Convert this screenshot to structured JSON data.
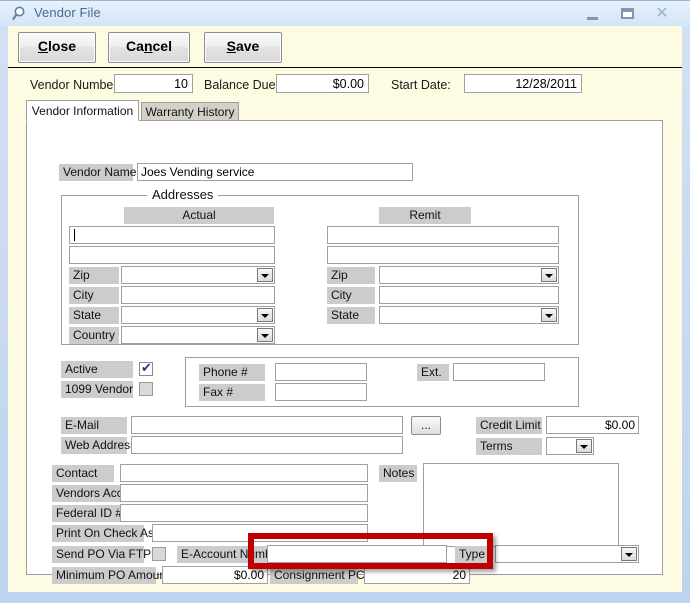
{
  "window": {
    "title": "Vendor File",
    "icon": "magnifier-icon",
    "minimize_label": "–",
    "maximize_label": "□",
    "close_label": "✕"
  },
  "toolbar": {
    "close": {
      "pre": "",
      "acc": "C",
      "post": "lose"
    },
    "cancel": {
      "pre": "Ca",
      "acc": "n",
      "post": "cel"
    },
    "save": {
      "pre": "",
      "acc": "S",
      "post": "ave"
    }
  },
  "header": {
    "vendor_number_label": "Vendor Number",
    "vendor_number_value": "10",
    "balance_due_label": "Balance Due:",
    "balance_due_value": "$0.00",
    "start_date_label": "Start Date:",
    "start_date_value": "12/28/2011"
  },
  "tabs": [
    {
      "label": "Vendor Information",
      "active": true
    },
    {
      "label": "Warranty History",
      "active": false
    }
  ],
  "form": {
    "vendor_name_label": "Vendor Name",
    "vendor_name_value": "Joes Vending service",
    "addresses_title": "Addresses",
    "actual_header": "Actual",
    "remit_header": "Remit",
    "actual": {
      "line1": "",
      "line2": "",
      "zip_label": "Zip",
      "zip_value": "",
      "city_label": "City",
      "city_value": "",
      "state_label": "State",
      "state_value": "",
      "country_label": "Country",
      "country_value": ""
    },
    "remit": {
      "line1": "",
      "line2": "",
      "zip_label": "Zip",
      "zip_value": "",
      "city_label": "City",
      "city_value": "",
      "state_label": "State",
      "state_value": ""
    },
    "active_label": "Active",
    "active_checked": true,
    "vendor1099_label": "1099 Vendor",
    "vendor1099_checked": false,
    "phone_label": "Phone #",
    "phone_value": "",
    "fax_label": "Fax #",
    "fax_value": "",
    "ext_label": "Ext.",
    "ext_value": "",
    "email_label": "E-Mail",
    "email_value": "",
    "web_address_label": "Web Address",
    "web_address_value": "",
    "ellipsis_label": "...",
    "credit_limit_label": "Credit Limit",
    "credit_limit_value": "$0.00",
    "terms_label": "Terms",
    "terms_value": "",
    "contact_label": "Contact",
    "contact_value": "",
    "vendors_acct_label": "Vendors Acct #",
    "vendors_acct_value": "",
    "federal_id_label": "Federal ID #",
    "federal_id_value": "",
    "notes_label": "Notes",
    "notes_value": "",
    "print_on_check_label": "Print On Check As",
    "print_on_check_value": "",
    "send_po_ftp_label": "Send PO Via FTP ?",
    "send_po_ftp_checked": false,
    "eaccount_label": "E-Account Number",
    "eaccount_value": "",
    "type_label": "Type",
    "type_value": "",
    "minimum_po_label": "Minimum PO Amount",
    "minimum_po_value": "$0.00",
    "consignment_label": "Consignment PCT",
    "consignment_value": "20"
  },
  "annotation": {
    "highlight_color": "#c00000",
    "highlight_target": "consignment-pct-field"
  }
}
